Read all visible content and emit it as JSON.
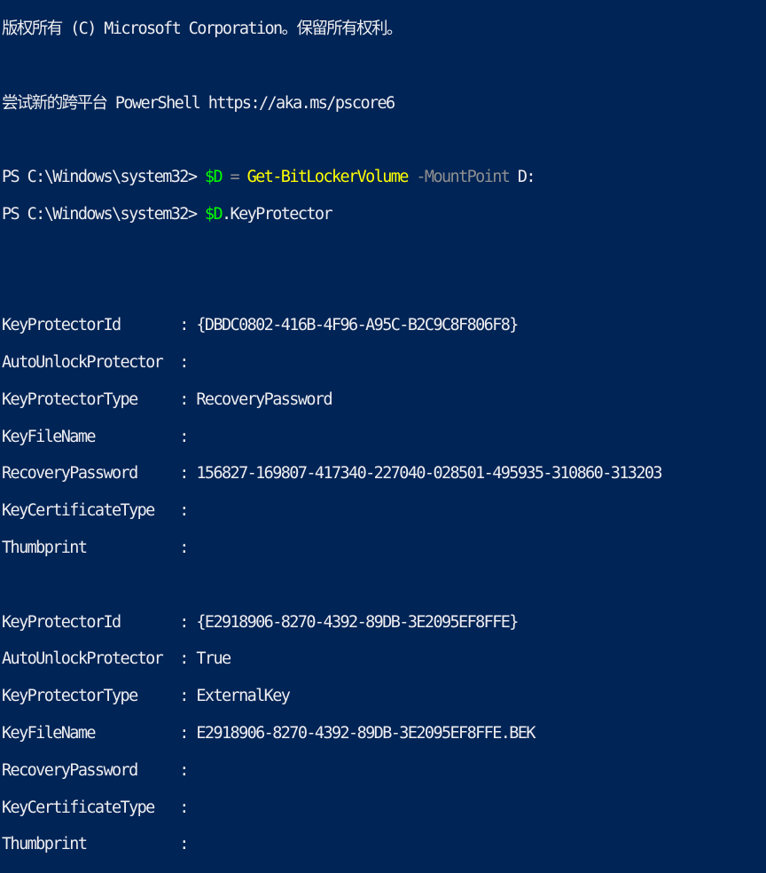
{
  "header": {
    "copyright": "版权所有 (C) Microsoft Corporation。保留所有权利。",
    "try_new": "尝试新的跨平台 PowerShell https://aka.ms/pscore6"
  },
  "commands": [
    {
      "prompt": "PS C:\\Windows\\system32> ",
      "var": "$D",
      "op": " = ",
      "cmdlet": "Get-BitLockerVolume",
      "param": " -MountPoint",
      "arg": " D:"
    },
    {
      "prompt": "PS C:\\Windows\\system32> ",
      "var": "$D",
      "member": ".KeyProtector"
    }
  ],
  "protectors": [
    [
      {
        "label": "KeyProtectorId       : ",
        "value": "{DBDC0802-416B-4F96-A95C-B2C9C8F806F8}"
      },
      {
        "label": "AutoUnlockProtector  : ",
        "value": ""
      },
      {
        "label": "KeyProtectorType     : ",
        "value": "RecoveryPassword"
      },
      {
        "label": "KeyFileName          : ",
        "value": ""
      },
      {
        "label": "RecoveryPassword     : ",
        "value": "156827-169807-417340-227040-028501-495935-310860-313203"
      },
      {
        "label": "KeyCertificateType   : ",
        "value": ""
      },
      {
        "label": "Thumbprint           : ",
        "value": ""
      }
    ],
    [
      {
        "label": "KeyProtectorId       : ",
        "value": "{E2918906-8270-4392-89DB-3E2095EF8FFE}"
      },
      {
        "label": "AutoUnlockProtector  : ",
        "value": "True"
      },
      {
        "label": "KeyProtectorType     : ",
        "value": "ExternalKey"
      },
      {
        "label": "KeyFileName          : ",
        "value": "E2918906-8270-4392-89DB-3E2095EF8FFE.BEK"
      },
      {
        "label": "RecoveryPassword     : ",
        "value": ""
      },
      {
        "label": "KeyCertificateType   : ",
        "value": ""
      },
      {
        "label": "Thumbprint           : ",
        "value": ""
      }
    ]
  ],
  "colors": {
    "background": "#012456",
    "text": "#eeedf0",
    "variable": "#00ff00",
    "cmdlet": "#ffff00",
    "parameter": "#8f8f8f"
  }
}
